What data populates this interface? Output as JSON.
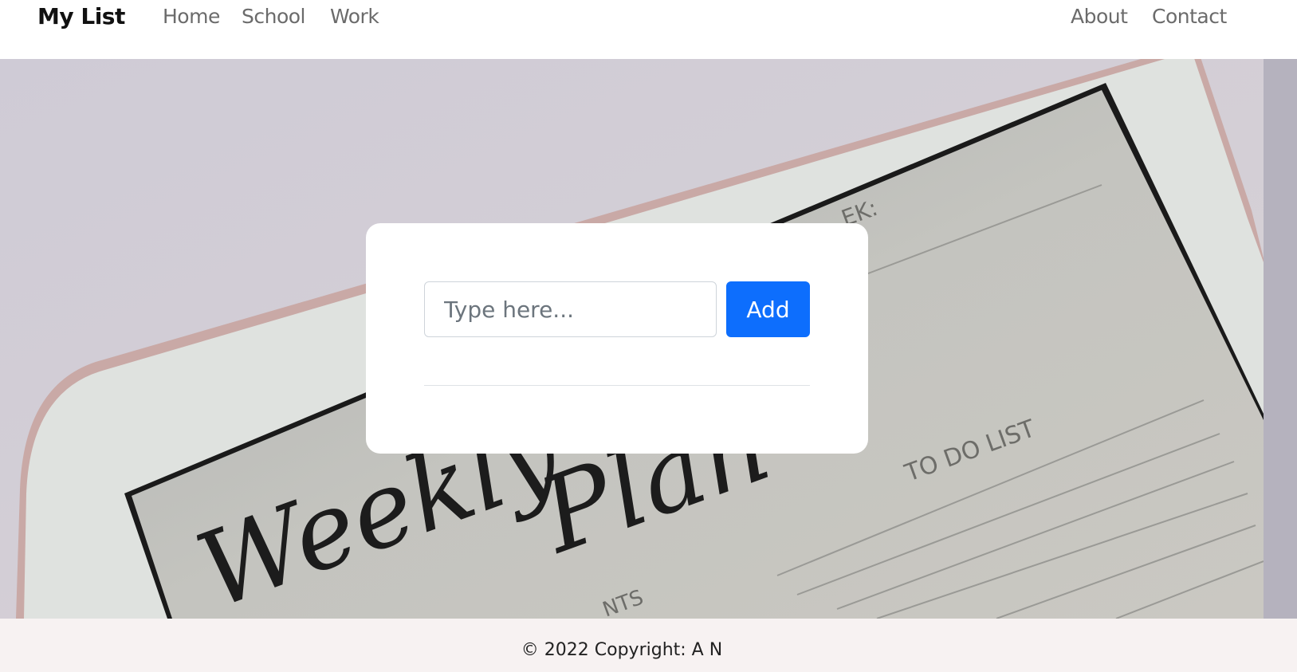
{
  "navbar": {
    "brand": "My List",
    "left_links": [
      "Home",
      "School",
      "Work"
    ],
    "right_links": [
      "About",
      "Contact"
    ]
  },
  "hero": {
    "background_texts": [
      "Weekly",
      "Plan",
      "TO DO LIST",
      "EK:",
      "NTS"
    ]
  },
  "todo": {
    "input_placeholder": "Type here...",
    "input_value": "",
    "add_label": "Add"
  },
  "footer": {
    "copyright": "© 2022 Copyright: A N"
  },
  "colors": {
    "accent": "#0d6efd",
    "nav_text": "#6b6b6b",
    "footer_bg": "#f7f1f1"
  }
}
